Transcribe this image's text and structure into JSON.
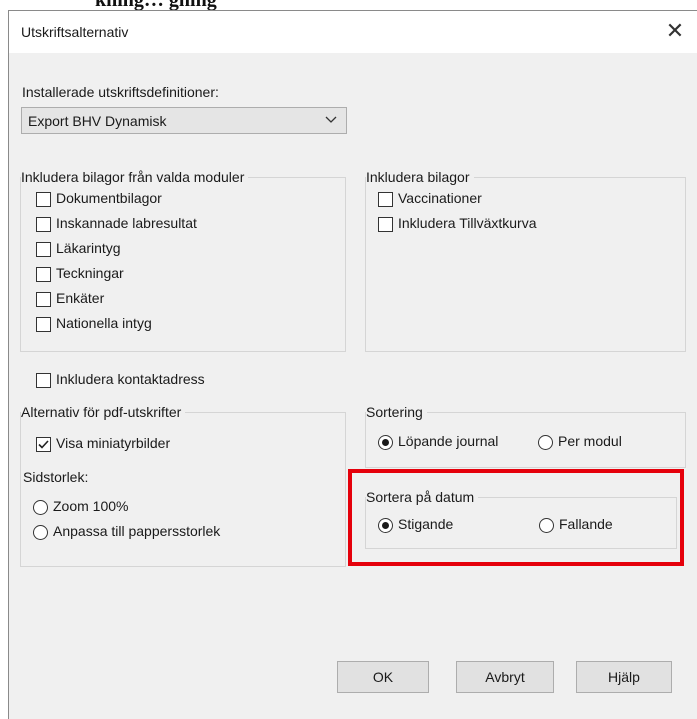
{
  "dialog": {
    "title": "Utskriftsalternativ",
    "installed_label": "Installerade utskriftsdefinitioner:",
    "installed_value": "Export BHV Dynamisk",
    "modules_group": {
      "title": "Inkludera bilagor från valda moduler",
      "items": [
        {
          "label": "Dokumentbilagor",
          "checked": false
        },
        {
          "label": "Inskannade labresultat",
          "checked": false
        },
        {
          "label": "Läkarintyg",
          "checked": false
        },
        {
          "label": "Teckningar",
          "checked": false
        },
        {
          "label": "Enkäter",
          "checked": false
        },
        {
          "label": "Nationella intyg",
          "checked": false
        }
      ]
    },
    "attachments_group": {
      "title": "Inkludera bilagor",
      "items": [
        {
          "label": "Vaccinationer",
          "checked": false
        },
        {
          "label": "Inkludera Tillväxtkurva",
          "checked": false
        }
      ]
    },
    "contact_address": {
      "label": "Inkludera kontaktadress",
      "checked": false
    },
    "pdf_group": {
      "title": "Alternativ för pdf-utskrifter",
      "thumbnails": {
        "label": "Visa miniatyrbilder",
        "checked": true
      },
      "page_size_label": "Sidstorlek:",
      "page_size_options": [
        {
          "label": "Zoom 100%",
          "selected": false
        },
        {
          "label": "Anpassa till pappersstorlek",
          "selected": false
        }
      ]
    },
    "sorting_group": {
      "title": "Sortering",
      "options": [
        {
          "label": "Löpande journal",
          "selected": true
        },
        {
          "label": "Per modul",
          "selected": false
        }
      ]
    },
    "date_sort_group": {
      "title": "Sortera på datum",
      "options": [
        {
          "label": "Stigande",
          "selected": true
        },
        {
          "label": "Fallande",
          "selected": false
        }
      ]
    },
    "buttons": {
      "ok": "OK",
      "cancel": "Avbryt",
      "help": "Hjälp"
    }
  },
  "colors": {
    "highlight": "#e5000b",
    "dialog_bg": "#f0f0f0"
  },
  "icons": {
    "close": "close-icon",
    "dropdown": "chevron-down-icon",
    "check": "check-icon"
  }
}
